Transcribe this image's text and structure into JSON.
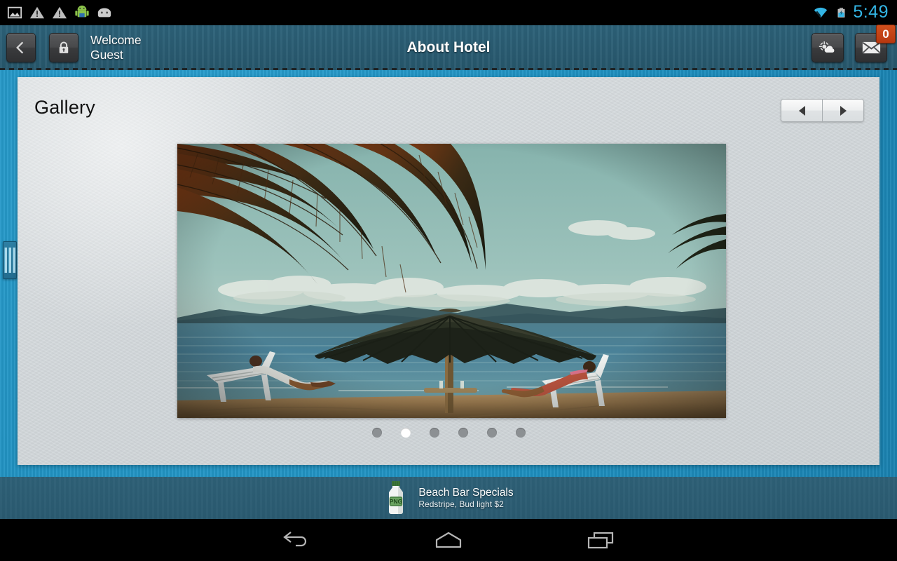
{
  "statusbar": {
    "icons": [
      "image-icon",
      "warning-icon",
      "warning-icon",
      "android-robot-icon",
      "android-head-icon"
    ],
    "wifi_icon": "wifi-icon",
    "battery_icon": "battery-charging-icon",
    "clock": "5:49"
  },
  "header": {
    "back_icon": "chevron-left-icon",
    "lock_icon": "lock-icon",
    "welcome_line1": "Welcome",
    "welcome_line2": "Guest",
    "title": "About Hotel",
    "weather_icon": "sun-cloud-icon",
    "mail_icon": "envelope-icon",
    "mail_badge": "0",
    "bg_color": "#2a5c72"
  },
  "drawer": {
    "handle_icon": "drawer-handle-icon"
  },
  "card": {
    "gallery_title": "Gallery",
    "prev_icon": "triangle-left-icon",
    "next_icon": "triangle-right-icon",
    "photo_alt": "beach-photo-palm-umbrella-loungers",
    "dots": [
      {
        "active": false
      },
      {
        "active": true
      },
      {
        "active": false
      },
      {
        "active": false
      },
      {
        "active": false
      },
      {
        "active": false
      }
    ],
    "bg_color": "#d6dbde"
  },
  "ad": {
    "icon": "png-bottle-icon",
    "title": "Beach Bar Specials",
    "subtitle": "Redstripe, Bud light $2",
    "bg_color": "#2b5b71"
  },
  "navbar": {
    "back_icon": "android-back-icon",
    "home_icon": "android-home-icon",
    "recents_icon": "android-recents-icon"
  }
}
